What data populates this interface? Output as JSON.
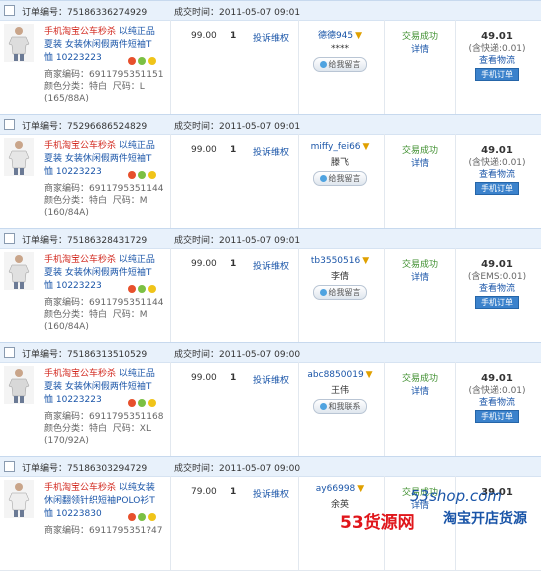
{
  "labels": {
    "order_no": "订单编号：",
    "deal_time": "成交时间：",
    "complain": "投诉维权",
    "message_btn": "给我留言",
    "contact_btn": "和我联系",
    "trade_success": "交易成功",
    "detail": "详情",
    "view_logistics": "查看物流",
    "mobile_order": "手机订单",
    "merchant_code": "商家编码：",
    "color": "颜色分类：",
    "size": "尺码："
  },
  "orders": [
    {
      "order_no": "75186336274929",
      "time": "2011-05-07 09:01",
      "title_red": "手机淘宝公车秒杀",
      "title_rest": " 以纯正品 夏装 女装休闲假两件短袖T恤 10223223",
      "merchant_code": "6911795351151",
      "color": "特白",
      "size": "L",
      "size_spec": "(165/88A)",
      "price": "99.00",
      "qty": "1",
      "buyer": "德德945",
      "buyer_real": "****",
      "action_btn": "给我留言",
      "amount": "49.01",
      "shipping": "(含快递:0.01)"
    },
    {
      "order_no": "75296686524829",
      "time": "2011-05-07 09:01",
      "title_red": "手机淘宝公车秒杀",
      "title_rest": " 以纯正品 夏装 女装休闲假两件短袖T恤 10223223",
      "merchant_code": "6911795351144",
      "color": "特白",
      "size": "M",
      "size_spec": "(160/84A)",
      "price": "99.00",
      "qty": "1",
      "buyer": "miffy_fei66",
      "buyer_real": "滕飞",
      "action_btn": "给我留言",
      "amount": "49.01",
      "shipping": "(含快递:0.01)"
    },
    {
      "order_no": "75186328431729",
      "time": "2011-05-07 09:01",
      "title_red": "手机淘宝公车秒杀",
      "title_rest": " 以纯正品 夏装 女装休闲假两件短袖T恤 10223223",
      "merchant_code": "6911795351144",
      "color": "特白",
      "size": "M",
      "size_spec": "(160/84A)",
      "price": "99.00",
      "qty": "1",
      "buyer": "tb3550516",
      "buyer_real": "李倩",
      "action_btn": "给我留言",
      "amount": "49.01",
      "shipping": "(含EMS:0.01)"
    },
    {
      "order_no": "75186313510529",
      "time": "2011-05-07 09:00",
      "title_red": "手机淘宝公车秒杀",
      "title_rest": " 以纯正品 夏装 女装休闲假两件短袖T恤 10223223",
      "merchant_code": "6911795351168",
      "color": "特白",
      "size": "XL",
      "size_spec": "(170/92A)",
      "price": "99.00",
      "qty": "1",
      "buyer": "abc8850019",
      "buyer_real": "王伟",
      "action_btn": "和我联系",
      "amount": "49.01",
      "shipping": "(含快递:0.01)"
    },
    {
      "order_no": "75186303294729",
      "time": "2011-05-07 09:00",
      "title_red": "手机淘宝公车秒杀",
      "title_rest": " 以纯女装 休闲翻领针织短袖POLO衫T恤 10223830",
      "merchant_code": "6911795351?47",
      "color": "",
      "size": "",
      "size_spec": "",
      "price": "79.00",
      "qty": "1",
      "buyer": "ay66998",
      "buyer_real": "余英",
      "action_btn": "",
      "amount": "39.01",
      "shipping": ""
    }
  ],
  "watermark": {
    "site": "53shop.com",
    "brand": "53货源网",
    "slogan": "淘宝开店货源"
  }
}
